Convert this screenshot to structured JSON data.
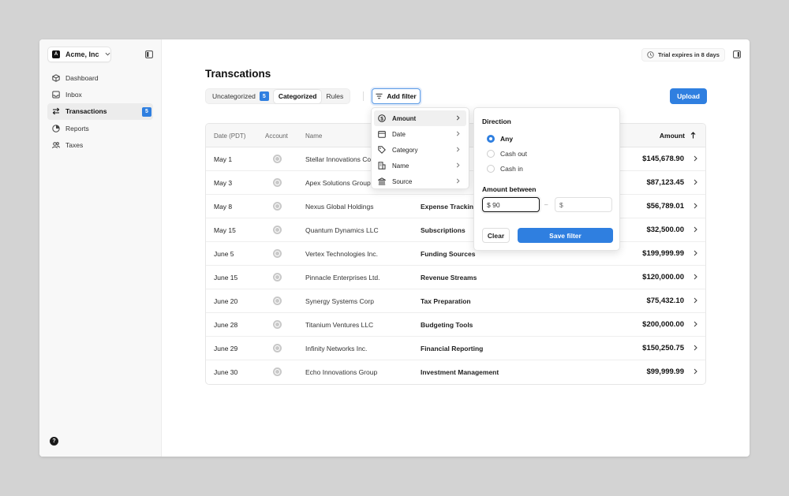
{
  "org": {
    "initial": "A",
    "name": "Acme, Inc"
  },
  "sidebar": {
    "items": [
      {
        "label": "Dashboard",
        "icon": "box-icon"
      },
      {
        "label": "Inbox",
        "icon": "inbox-icon"
      },
      {
        "label": "Transactions",
        "icon": "transfer-icon",
        "badge": "5",
        "active": true
      },
      {
        "label": "Reports",
        "icon": "pie-chart-icon"
      },
      {
        "label": "Taxes",
        "icon": "users-icon"
      }
    ],
    "help": "?"
  },
  "header": {
    "trial": "Trial expires in 8 days"
  },
  "page": {
    "title": "Transcations"
  },
  "tabs": {
    "uncategorized": "Uncategorized",
    "uncategorized_badge": "5",
    "categorized": "Categorized",
    "rules": "Rules"
  },
  "toolbar": {
    "add_filter": "Add filter",
    "upload": "Upload"
  },
  "table": {
    "headers": {
      "date": "Date (PDT)",
      "account": "Account",
      "name": "Name",
      "amount": "Amount"
    },
    "rows": [
      {
        "date": "May 1",
        "name": "Stellar Innovations Corp",
        "category": "",
        "amount": "$145,678.90"
      },
      {
        "date": "May 3",
        "name": "Apex Solutions Group",
        "category": "",
        "amount": "$87,123.45"
      },
      {
        "date": "May 8",
        "name": "Nexus Global Holdings",
        "category": "Expense Tracking",
        "amount": "$56,789.01"
      },
      {
        "date": "May 15",
        "name": "Quantum Dynamics LLC",
        "category": "Subscriptions",
        "amount": "$32,500.00"
      },
      {
        "date": "June 5",
        "name": "Vertex Technologies Inc.",
        "category": "Funding Sources",
        "amount": "$199,999.99"
      },
      {
        "date": "June 15",
        "name": "Pinnacle Enterprises Ltd.",
        "category": "Revenue Streams",
        "amount": "$120,000.00"
      },
      {
        "date": "June 20",
        "name": "Synergy Systems Corp",
        "category": "Tax Preparation",
        "amount": "$75,432.10"
      },
      {
        "date": "June 28",
        "name": "Titanium Ventures LLC",
        "category": "Budgeting Tools",
        "amount": "$200,000.00"
      },
      {
        "date": "June 29",
        "name": "Infinity Networks Inc.",
        "category": "Financial Reporting",
        "amount": "$150,250.75"
      },
      {
        "date": "June 30",
        "name": "Echo Innovations Group",
        "category": "Investment Management",
        "amount": "$99,999.99"
      }
    ]
  },
  "filter_menu": {
    "items": [
      {
        "label": "Amount",
        "icon": "dollar-icon",
        "active": true
      },
      {
        "label": "Date",
        "icon": "calendar-icon"
      },
      {
        "label": "Category",
        "icon": "tag-icon"
      },
      {
        "label": "Name",
        "icon": "building-icon"
      },
      {
        "label": "Source",
        "icon": "bank-icon"
      }
    ]
  },
  "amount_filter": {
    "direction_title": "Direction",
    "options": [
      "Any",
      "Cash out",
      "Cash in"
    ],
    "selected": "Any",
    "between_title": "Amount between",
    "min_value": "$ 90",
    "max_value": "$",
    "dash": "–",
    "clear": "Clear",
    "save": "Save filter"
  },
  "colors": {
    "accent": "#2f7fe0",
    "background": "#d3d3d3"
  }
}
